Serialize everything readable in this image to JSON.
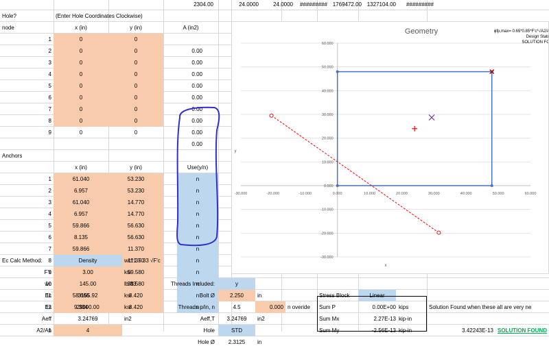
{
  "top_row": [
    "2304.00",
    "24.0000",
    "24.0000",
    "#########",
    "1769472.00",
    "1327104.00",
    "#########"
  ],
  "hole": {
    "label": "Hole?",
    "instruction": "(Enter Hole Coordinates Clockwise)",
    "headers": [
      "node",
      "x (in)",
      "y (in)",
      "A (in2)"
    ],
    "rows": [
      {
        "n": "1",
        "x": "0",
        "y": "0",
        "a": ""
      },
      {
        "n": "2",
        "x": "0",
        "y": "0",
        "a": "0.00"
      },
      {
        "n": "3",
        "x": "0",
        "y": "0",
        "a": "0.00"
      },
      {
        "n": "4",
        "x": "0",
        "y": "0",
        "a": "0.00"
      },
      {
        "n": "5",
        "x": "0",
        "y": "0",
        "a": "0.00"
      },
      {
        "n": "6",
        "x": "0",
        "y": "0",
        "a": "0.00"
      },
      {
        "n": "7",
        "x": "0",
        "y": "0",
        "a": "0.00"
      },
      {
        "n": "8",
        "x": "0",
        "y": "0",
        "a": "0.00"
      },
      {
        "n": "9",
        "x": "0",
        "y": "0",
        "a": "0.00"
      }
    ],
    "total_a": "0.00"
  },
  "anchors": {
    "label": "Anchors",
    "headers": [
      "x (in)",
      "y (in)",
      "Use(y/n)"
    ],
    "rows": [
      {
        "n": "1",
        "x": "61.040",
        "y": "53.230",
        "use": "n"
      },
      {
        "n": "2",
        "x": "6.957",
        "y": "53.230",
        "use": "n"
      },
      {
        "n": "3",
        "x": "61.040",
        "y": "14.770",
        "use": "n"
      },
      {
        "n": "4",
        "x": "6.957",
        "y": "14.770",
        "use": "n"
      },
      {
        "n": "5",
        "x": "59.866",
        "y": "56.630",
        "use": "n"
      },
      {
        "n": "6",
        "x": "8.135",
        "y": "56.630",
        "use": "n"
      },
      {
        "n": "7",
        "x": "59.866",
        "y": "11.370",
        "use": "n"
      },
      {
        "n": "8",
        "x": "8.135",
        "y": "11.370",
        "use": "n"
      },
      {
        "n": "9",
        "x": "58.666",
        "y": "59.580",
        "use": "n"
      },
      {
        "n": "10",
        "x": "9.334",
        "y": "59.580",
        "use": "n"
      },
      {
        "n": "11",
        "x": "58.666",
        "y": "8.420",
        "use": "n"
      },
      {
        "n": "12",
        "x": "9.334",
        "y": "8.420",
        "use": "n"
      }
    ]
  },
  "ec": {
    "method_label": "Ec Calc Method:",
    "method_value": "Density",
    "formula": "wc^1.5 33 √F'c",
    "rows": [
      {
        "label": "F'c",
        "value": "3.00",
        "unit": "ksi"
      },
      {
        "label": "wc",
        "value": "145.00",
        "unit": "lb/ft3"
      },
      {
        "label": "Ec",
        "value": "3155.92",
        "unit": "ksi"
      },
      {
        "label": "Es",
        "value": "29000.00",
        "unit": "ksi"
      },
      {
        "label": "Aeff",
        "value": "3.24769",
        "unit": "in2"
      },
      {
        "label": "n",
        "value": "9.1891",
        "unit": ""
      }
    ],
    "a2a1_label": "A2/A1",
    "a2a1_value": "4"
  },
  "bolt": {
    "threads_label": "Threads Included:",
    "threads_value": "y",
    "bolt_label": "Bolt Ø",
    "bolt_value": "2.250",
    "bolt_unit": "in",
    "tpi_label": "Threads p/in, n",
    "tpi_value": "4.5",
    "override_value": "0.000",
    "override_label": "n overide",
    "aeff_label": "Aeff,T",
    "aeff_value": "3.24769",
    "aeff_unit": "in2",
    "hole_label": "Hole",
    "hole_value": "STD",
    "hole_dia_label": "Hole Ø",
    "hole_dia_value": "2.3125",
    "hole_dia_unit": "in"
  },
  "stress": {
    "label": "Stress Block",
    "value": "Linear",
    "rows": [
      {
        "label": "Sum P",
        "value": "0.00E+00",
        "unit": "kips"
      },
      {
        "label": "Sum Mx",
        "value": "2.27E-13",
        "unit": "kip-in"
      },
      {
        "label": "Sum My",
        "value": "-2.56E-13",
        "unit": "kip-in"
      }
    ],
    "note": "Solution Found when these all are very ne",
    "result_value": "3.42243E-13",
    "result_label": "SOLUTION FOUND"
  },
  "chart_side": {
    "line1": "ϕfp,max= 0.65*0.85*F'c*√A2/A",
    "line2": "Design Statu",
    "line3": "SOLUTION FO"
  },
  "chart_data": {
    "type": "scatter",
    "title": "Geometry",
    "xlabel": "x",
    "ylabel": "y",
    "xlim": [
      -30,
      60
    ],
    "ylim": [
      -30,
      60
    ],
    "x_ticks": [
      "-30.000",
      "-20.000",
      "-10.000",
      "0.000",
      "10.000",
      "20.000",
      "30.000",
      "40.000",
      "50.000",
      "60.000"
    ],
    "y_ticks": [
      "60.000",
      "50.000",
      "40.000",
      "30.000",
      "20.000",
      "10.000",
      "0.000",
      "-10.000",
      "-20.000",
      "-30.000"
    ],
    "series": [
      {
        "kind": "polygon",
        "color": "#4472c4",
        "points": [
          [
            0,
            0
          ],
          [
            0,
            48
          ],
          [
            48,
            48
          ],
          [
            48,
            0
          ],
          [
            0,
            0
          ]
        ]
      },
      {
        "kind": "dashed-line",
        "color": "#ff0000",
        "points": [
          [
            -20.5,
            29.5
          ],
          [
            31.5,
            -19.8
          ]
        ]
      },
      {
        "kind": "plus-marker",
        "color": "#ff0000",
        "points": [
          [
            24,
            24
          ]
        ]
      },
      {
        "kind": "x-marker",
        "color": "#7030a0",
        "points": [
          [
            29.3,
            28.7
          ]
        ]
      },
      {
        "kind": "star-marker",
        "color": "#c00000",
        "points": [
          [
            48,
            48
          ]
        ]
      }
    ]
  }
}
